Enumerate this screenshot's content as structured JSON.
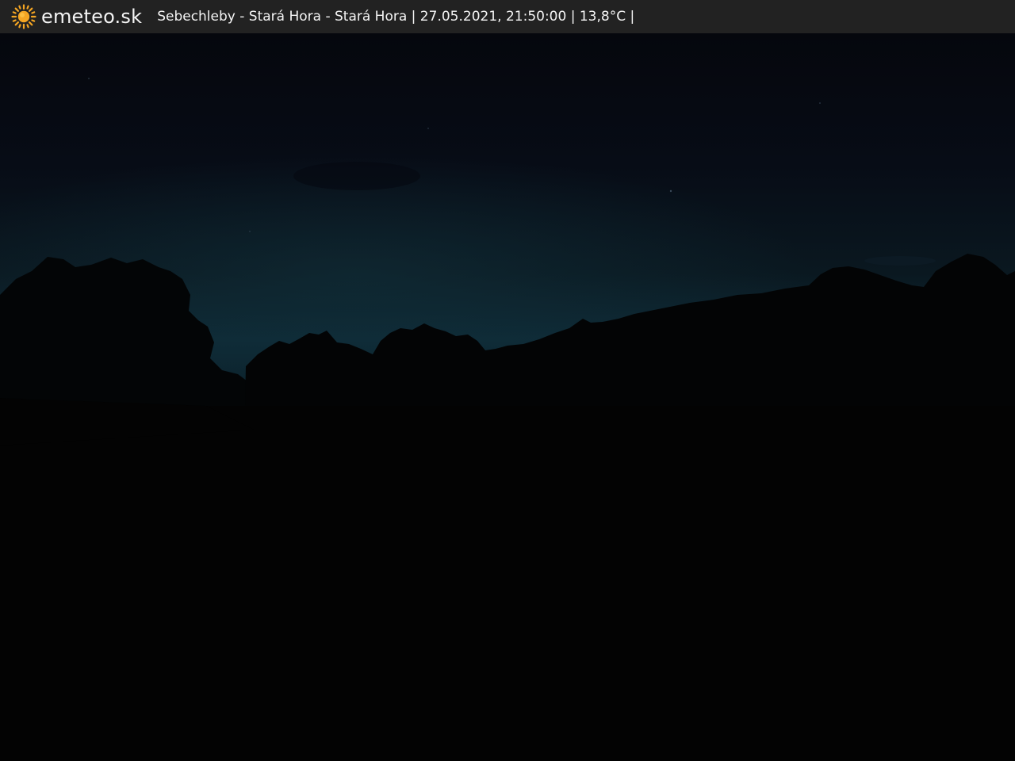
{
  "header": {
    "brand": "emeteo.sk",
    "logo_icon": "sun-icon",
    "caption": "Sebechleby - Stará Hora - Stará Hora | 27.05.2021, 21:50:00 | 13,8°C |"
  },
  "colors": {
    "bar_background": "#222222",
    "text": "#f4f4f4",
    "sun": "#f5a623",
    "sky_top": "#05080f",
    "sky_horizon": "#0e2a36",
    "ground": "#030303"
  },
  "scene": {
    "description_icon": "webcam-night-landscape"
  }
}
